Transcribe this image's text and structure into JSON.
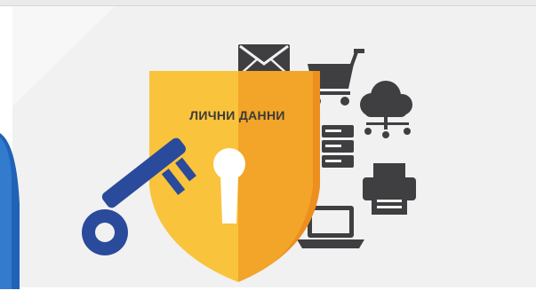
{
  "shield": {
    "label": "ЛИЧНИ ДАННИ",
    "colors": {
      "left": "#f9c33c",
      "right": "#f2a528",
      "keyhole": "#ffffff"
    }
  },
  "key": {
    "color": "#2a4a9c"
  },
  "background": {
    "panel": "#f2f2f2",
    "accent_left": "#1f62b7"
  },
  "icons": {
    "color": "#3f3f41",
    "names": [
      "envelope-icon",
      "shopping-cart-icon",
      "cloud-network-icon",
      "server-icon",
      "printer-icon",
      "laptop-icon"
    ]
  }
}
